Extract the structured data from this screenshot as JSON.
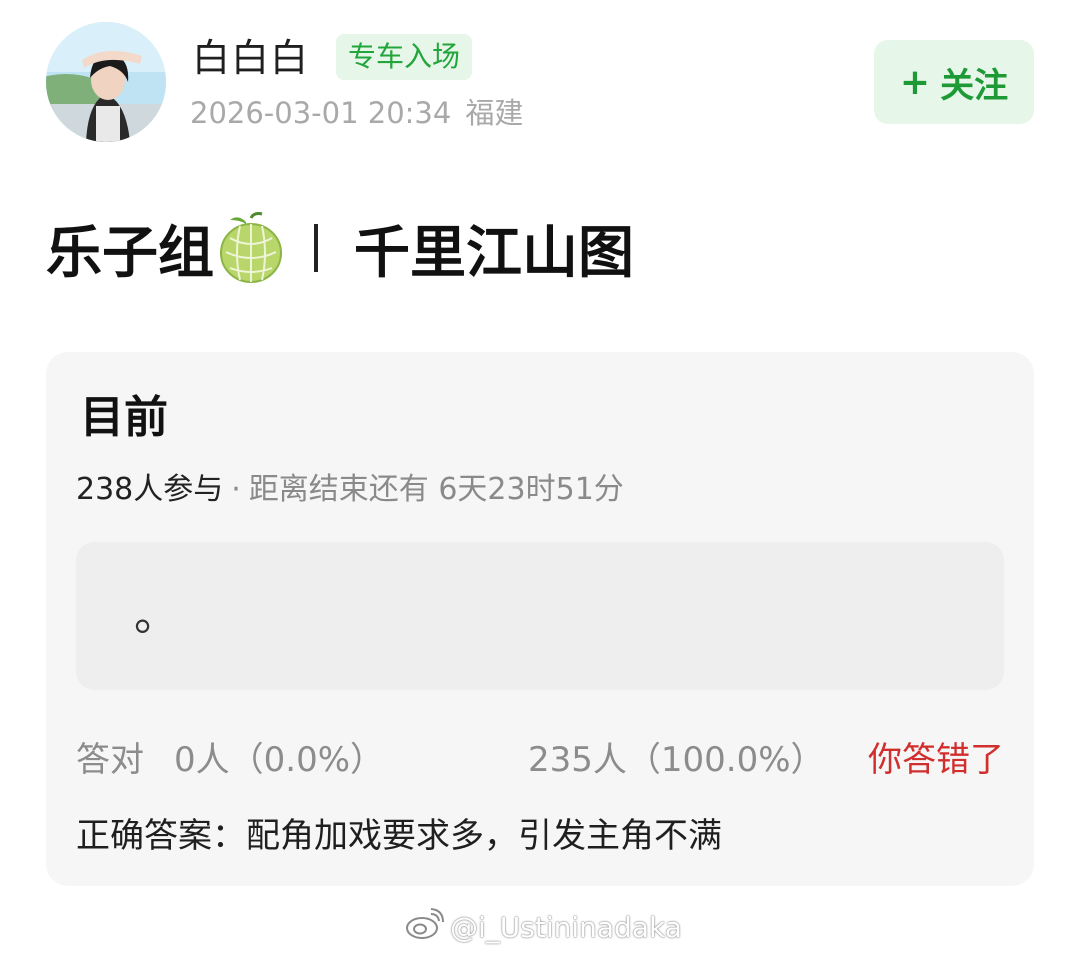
{
  "header": {
    "username": "白白白",
    "badge": "专车入场",
    "date": "2026-03-01 20:34",
    "location": "福建",
    "follow_plus": "+",
    "follow_label": "关注"
  },
  "post": {
    "title_left": "乐子组",
    "title_emoji": "melon-icon",
    "title_right": "千里江山图"
  },
  "quiz": {
    "title": "目前",
    "participants": "238人参与",
    "separator": "·",
    "countdown": "距离结束还有 6天23时51分",
    "option_text": "。",
    "correct_label": "答对",
    "correct_count": "0人（0.0%）",
    "wrong_count": "235人（100.0%）",
    "wrong_label": "你答错了",
    "answer": "正确答案：配角加戏要求多，引发主角不满"
  },
  "watermark": {
    "handle": "@i_Ustininadaka",
    "icon": "weibo-icon"
  },
  "colors": {
    "accent_green": "#22a63c",
    "badge_bg": "#e6f6e8",
    "wrong_red": "#d12e2e",
    "card_bg": "#f6f6f6"
  }
}
